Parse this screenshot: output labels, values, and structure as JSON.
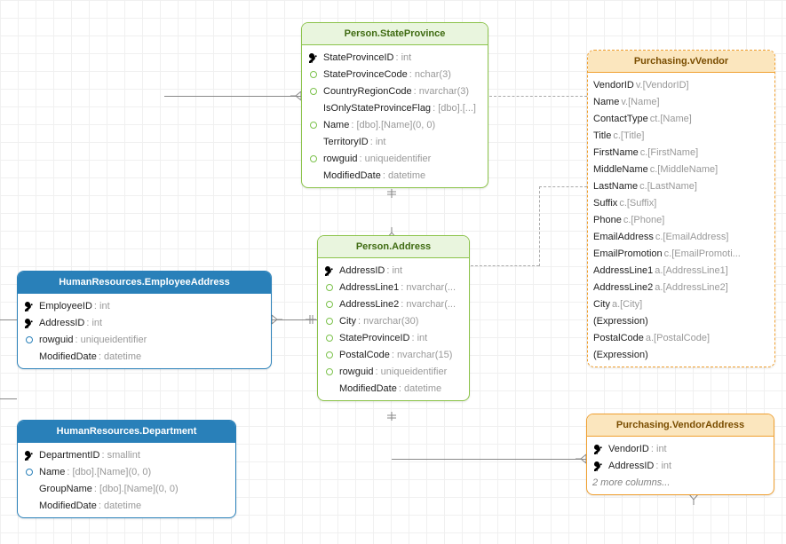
{
  "chart_data": {
    "type": "diagram",
    "entities": [
      {
        "name": "Person.StateProvince",
        "style": "green",
        "pk": [
          "StateProvinceID"
        ],
        "columns": [
          {
            "name": "StateProvinceID",
            "type": "int",
            "icon": "key"
          },
          {
            "name": "StateProvinceCode",
            "type": "nchar(3)",
            "icon": "fk"
          },
          {
            "name": "CountryRegionCode",
            "type": "nvarchar(3)",
            "icon": "fk"
          },
          {
            "name": "IsOnlyStateProvinceFlag",
            "type": "[dbo].[...",
            "icon": "col"
          },
          {
            "name": "Name",
            "type": "[dbo].[Name](0, 0)",
            "icon": "fk"
          },
          {
            "name": "TerritoryID",
            "type": "int",
            "icon": "col"
          },
          {
            "name": "rowguid",
            "type": "uniqueidentifier",
            "icon": "fk"
          },
          {
            "name": "ModifiedDate",
            "type": "datetime",
            "icon": "col"
          }
        ]
      },
      {
        "name": "Person.Address",
        "style": "green",
        "pk": [
          "AddressID"
        ],
        "columns": [
          {
            "name": "AddressID",
            "type": "int",
            "icon": "key"
          },
          {
            "name": "AddressLine1",
            "type": "nvarchar(...",
            "icon": "fk"
          },
          {
            "name": "AddressLine2",
            "type": "nvarchar(...",
            "icon": "fk"
          },
          {
            "name": "City",
            "type": "nvarchar(30)",
            "icon": "fk"
          },
          {
            "name": "StateProvinceID",
            "type": "int",
            "icon": "fk"
          },
          {
            "name": "PostalCode",
            "type": "nvarchar(15)",
            "icon": "fk"
          },
          {
            "name": "rowguid",
            "type": "uniqueidentifier",
            "icon": "fk"
          },
          {
            "name": "ModifiedDate",
            "type": "datetime",
            "icon": "col"
          }
        ]
      },
      {
        "name": "HumanResources.EmployeeAddress",
        "style": "blue",
        "pk": [
          "EmployeeID",
          "AddressID"
        ],
        "columns": [
          {
            "name": "EmployeeID",
            "type": "int",
            "icon": "key"
          },
          {
            "name": "AddressID",
            "type": "int",
            "icon": "key"
          },
          {
            "name": "rowguid",
            "type": "uniqueidentifier",
            "icon": "fk"
          },
          {
            "name": "ModifiedDate",
            "type": "datetime",
            "icon": "col"
          }
        ]
      },
      {
        "name": "HumanResources.Department",
        "style": "blue",
        "pk": [
          "DepartmentID"
        ],
        "columns": [
          {
            "name": "DepartmentID",
            "type": "smallint",
            "icon": "key"
          },
          {
            "name": "Name",
            "type": "[dbo].[Name](0, 0)",
            "icon": "fk"
          },
          {
            "name": "GroupName",
            "type": "[dbo].[Name](0, 0)",
            "icon": "col"
          },
          {
            "name": "ModifiedDate",
            "type": "datetime",
            "icon": "col"
          }
        ]
      },
      {
        "name": "Purchasing.vVendor",
        "style": "orange-dash",
        "columns": [
          {
            "name": "VendorID",
            "type": "v.[VendorID]",
            "icon": "none"
          },
          {
            "name": "Name",
            "type": "v.[Name]",
            "icon": "none"
          },
          {
            "name": "ContactType",
            "type": "ct.[Name]",
            "icon": "none"
          },
          {
            "name": "Title",
            "type": "c.[Title]",
            "icon": "none"
          },
          {
            "name": "FirstName",
            "type": "c.[FirstName]",
            "icon": "none"
          },
          {
            "name": "MiddleName",
            "type": "c.[MiddleName]",
            "icon": "none"
          },
          {
            "name": "LastName",
            "type": "c.[LastName]",
            "icon": "none"
          },
          {
            "name": "Suffix",
            "type": "c.[Suffix]",
            "icon": "none"
          },
          {
            "name": "Phone",
            "type": "c.[Phone]",
            "icon": "none"
          },
          {
            "name": "EmailAddress",
            "type": "c.[EmailAddress]",
            "icon": "none"
          },
          {
            "name": "EmailPromotion",
            "type": "c.[EmailPromoti...",
            "icon": "none"
          },
          {
            "name": "AddressLine1",
            "type": "a.[AddressLine1]",
            "icon": "none"
          },
          {
            "name": "AddressLine2",
            "type": "a.[AddressLine2]",
            "icon": "none"
          },
          {
            "name": "City",
            "type": "a.[City]",
            "icon": "none"
          },
          {
            "name": "(Expression)",
            "type": "",
            "icon": "none"
          },
          {
            "name": "PostalCode",
            "type": "a.[PostalCode]",
            "icon": "none"
          },
          {
            "name": "(Expression)",
            "type": "",
            "icon": "none"
          }
        ]
      },
      {
        "name": "Purchasing.VendorAddress",
        "style": "orange",
        "pk": [
          "VendorID",
          "AddressID"
        ],
        "extra": "2 more columns...",
        "columns": [
          {
            "name": "VendorID",
            "type": "int",
            "icon": "key"
          },
          {
            "name": "AddressID",
            "type": "int",
            "icon": "key"
          }
        ]
      }
    ],
    "relationships": [
      {
        "from": "Person.Address",
        "to": "Person.StateProvince",
        "via": "StateProvinceID",
        "card": "many-to-one"
      },
      {
        "from": "HumanResources.EmployeeAddress",
        "to": "Person.Address",
        "via": "AddressID",
        "card": "many-to-one"
      },
      {
        "from": "Purchasing.VendorAddress",
        "to": "Person.Address",
        "via": "AddressID",
        "card": "many-to-one"
      },
      {
        "from": "Purchasing.vVendor",
        "to": "Person.Address",
        "via": "AddressID",
        "card": "reference"
      },
      {
        "from": "Purchasing.vVendor",
        "to": "Person.StateProvince",
        "via": "StateProvinceID",
        "card": "reference"
      }
    ]
  },
  "t": {
    "stateprovince": "Person.StateProvince",
    "address": "Person.Address",
    "empaddr": "HumanResources.EmployeeAddress",
    "dept": "HumanResources.Department",
    "vvendor": "Purchasing.vVendor",
    "vendoraddr": "Purchasing.VendorAddress",
    "more": "2 more columns..."
  },
  "c": {
    "sp": [
      [
        "StateProvinceID",
        "int"
      ],
      [
        "StateProvinceCode",
        "nchar(3)"
      ],
      [
        "CountryRegionCode",
        "nvarchar(3)"
      ],
      [
        "IsOnlyStateProvinceFlag",
        "[dbo].[...]"
      ],
      [
        "Name",
        "[dbo].[Name](0, 0)"
      ],
      [
        "TerritoryID",
        "int"
      ],
      [
        "rowguid",
        "uniqueidentifier"
      ],
      [
        "ModifiedDate",
        "datetime"
      ]
    ],
    "ad": [
      [
        "AddressID",
        "int"
      ],
      [
        "AddressLine1",
        "nvarchar(..."
      ],
      [
        "AddressLine2",
        "nvarchar(..."
      ],
      [
        "City",
        "nvarchar(30)"
      ],
      [
        "StateProvinceID",
        "int"
      ],
      [
        "PostalCode",
        "nvarchar(15)"
      ],
      [
        "rowguid",
        "uniqueidentifier"
      ],
      [
        "ModifiedDate",
        "datetime"
      ]
    ],
    "ea": [
      [
        "EmployeeID",
        "int"
      ],
      [
        "AddressID",
        "int"
      ],
      [
        "rowguid",
        "uniqueidentifier"
      ],
      [
        "ModifiedDate",
        "datetime"
      ]
    ],
    "dp": [
      [
        "DepartmentID",
        "smallint"
      ],
      [
        "Name",
        "[dbo].[Name](0, 0)"
      ],
      [
        "GroupName",
        "[dbo].[Name](0, 0)"
      ],
      [
        "ModifiedDate",
        "datetime"
      ]
    ],
    "vv": [
      [
        "VendorID",
        "v.[VendorID]"
      ],
      [
        "Name",
        "v.[Name]"
      ],
      [
        "ContactType",
        "ct.[Name]"
      ],
      [
        "Title",
        "c.[Title]"
      ],
      [
        "FirstName",
        "c.[FirstName]"
      ],
      [
        "MiddleName",
        "c.[MiddleName]"
      ],
      [
        "LastName",
        "c.[LastName]"
      ],
      [
        "Suffix",
        "c.[Suffix]"
      ],
      [
        "Phone",
        "c.[Phone]"
      ],
      [
        "EmailAddress",
        "c.[EmailAddress]"
      ],
      [
        "EmailPromotion",
        "c.[EmailPromoti..."
      ],
      [
        "AddressLine1",
        "a.[AddressLine1]"
      ],
      [
        "AddressLine2",
        "a.[AddressLine2]"
      ],
      [
        "City",
        "a.[City]"
      ],
      [
        "(Expression)",
        ""
      ],
      [
        "PostalCode",
        "a.[PostalCode]"
      ],
      [
        "(Expression)",
        ""
      ]
    ],
    "va": [
      [
        "VendorID",
        "int"
      ],
      [
        "AddressID",
        "int"
      ]
    ]
  }
}
